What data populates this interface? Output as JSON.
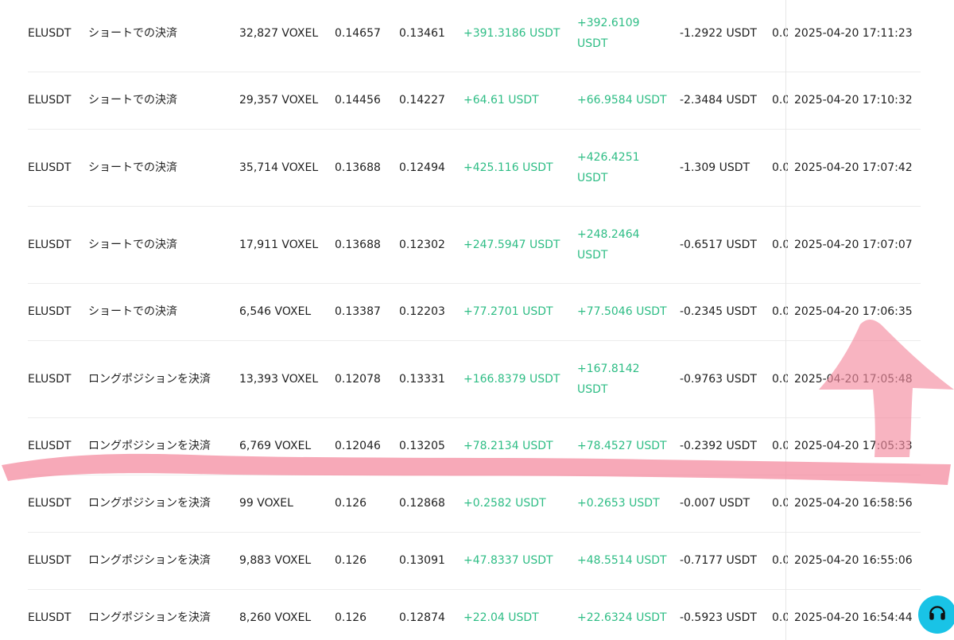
{
  "rows": [
    {
      "symbol": "ELUSDT",
      "side": "ショートでの決済",
      "qty": "32,827 VOXEL",
      "open": "0.14657",
      "close": "0.13461",
      "pnl": "+391.3186 USDT",
      "pnl2": "+392.6109 USDT",
      "fee": "-1.2922 USDT",
      "extra": "0.0",
      "time": "2025-04-20 17:11:23"
    },
    {
      "symbol": "ELUSDT",
      "side": "ショートでの決済",
      "qty": "29,357 VOXEL",
      "open": "0.14456",
      "close": "0.14227",
      "pnl": "+64.61 USDT",
      "pnl2": "+66.9584 USDT",
      "fee": "-2.3484 USDT",
      "extra": "0.0",
      "time": "2025-04-20 17:10:32"
    },
    {
      "symbol": "ELUSDT",
      "side": "ショートでの決済",
      "qty": "35,714 VOXEL",
      "open": "0.13688",
      "close": "0.12494",
      "pnl": "+425.116 USDT",
      "pnl2": "+426.4251 USDT",
      "fee": "-1.309 USDT",
      "extra": "0.0",
      "time": "2025-04-20 17:07:42"
    },
    {
      "symbol": "ELUSDT",
      "side": "ショートでの決済",
      "qty": "17,911 VOXEL",
      "open": "0.13688",
      "close": "0.12302",
      "pnl": "+247.5947 USDT",
      "pnl2": "+248.2464 USDT",
      "fee": "-0.6517 USDT",
      "extra": "0.0",
      "time": "2025-04-20 17:07:07"
    },
    {
      "symbol": "ELUSDT",
      "side": "ショートでの決済",
      "qty": "6,546 VOXEL",
      "open": "0.13387",
      "close": "0.12203",
      "pnl": "+77.2701 USDT",
      "pnl2": "+77.5046 USDT",
      "fee": "-0.2345 USDT",
      "extra": "0.0",
      "time": "2025-04-20 17:06:35"
    },
    {
      "symbol": "ELUSDT",
      "side": "ロングポジションを決済",
      "qty": "13,393 VOXEL",
      "open": "0.12078",
      "close": "0.13331",
      "pnl": "+166.8379 USDT",
      "pnl2": "+167.8142 USDT",
      "fee": "-0.9763 USDT",
      "extra": "0.0",
      "time": "2025-04-20 17:05:48"
    },
    {
      "symbol": "ELUSDT",
      "side": "ロングポジションを決済",
      "qty": "6,769 VOXEL",
      "open": "0.12046",
      "close": "0.13205",
      "pnl": "+78.2134 USDT",
      "pnl2": "+78.4527 USDT",
      "fee": "-0.2392 USDT",
      "extra": "0.0",
      "time": "2025-04-20 17:05:33"
    },
    {
      "symbol": "ELUSDT",
      "side": "ロングポジションを決済",
      "qty": "99 VOXEL",
      "open": "0.126",
      "close": "0.12868",
      "pnl": "+0.2582 USDT",
      "pnl2": "+0.2653 USDT",
      "fee": "-0.007 USDT",
      "extra": "0.0",
      "time": "2025-04-20 16:58:56"
    },
    {
      "symbol": "ELUSDT",
      "side": "ロングポジションを決済",
      "qty": "9,883 VOXEL",
      "open": "0.126",
      "close": "0.13091",
      "pnl": "+47.8337 USDT",
      "pnl2": "+48.5514 USDT",
      "fee": "-0.7177 USDT",
      "extra": "0.0",
      "time": "2025-04-20 16:55:06"
    },
    {
      "symbol": "ELUSDT",
      "side": "ロングポジションを決済",
      "qty": "8,260 VOXEL",
      "open": "0.126",
      "close": "0.12874",
      "pnl": "+22.04 USDT",
      "pnl2": "+22.6324 USDT",
      "fee": "-0.5923 USDT",
      "extra": "0.0",
      "time": "2025-04-20 16:54:44"
    }
  ],
  "colors": {
    "profit": "#2ebd85",
    "text": "#1f1f1f",
    "divider": "#ececec",
    "support_button": "#19c3e6",
    "annotation": "#f48ca0"
  },
  "icons": {
    "support": "headset-icon"
  }
}
